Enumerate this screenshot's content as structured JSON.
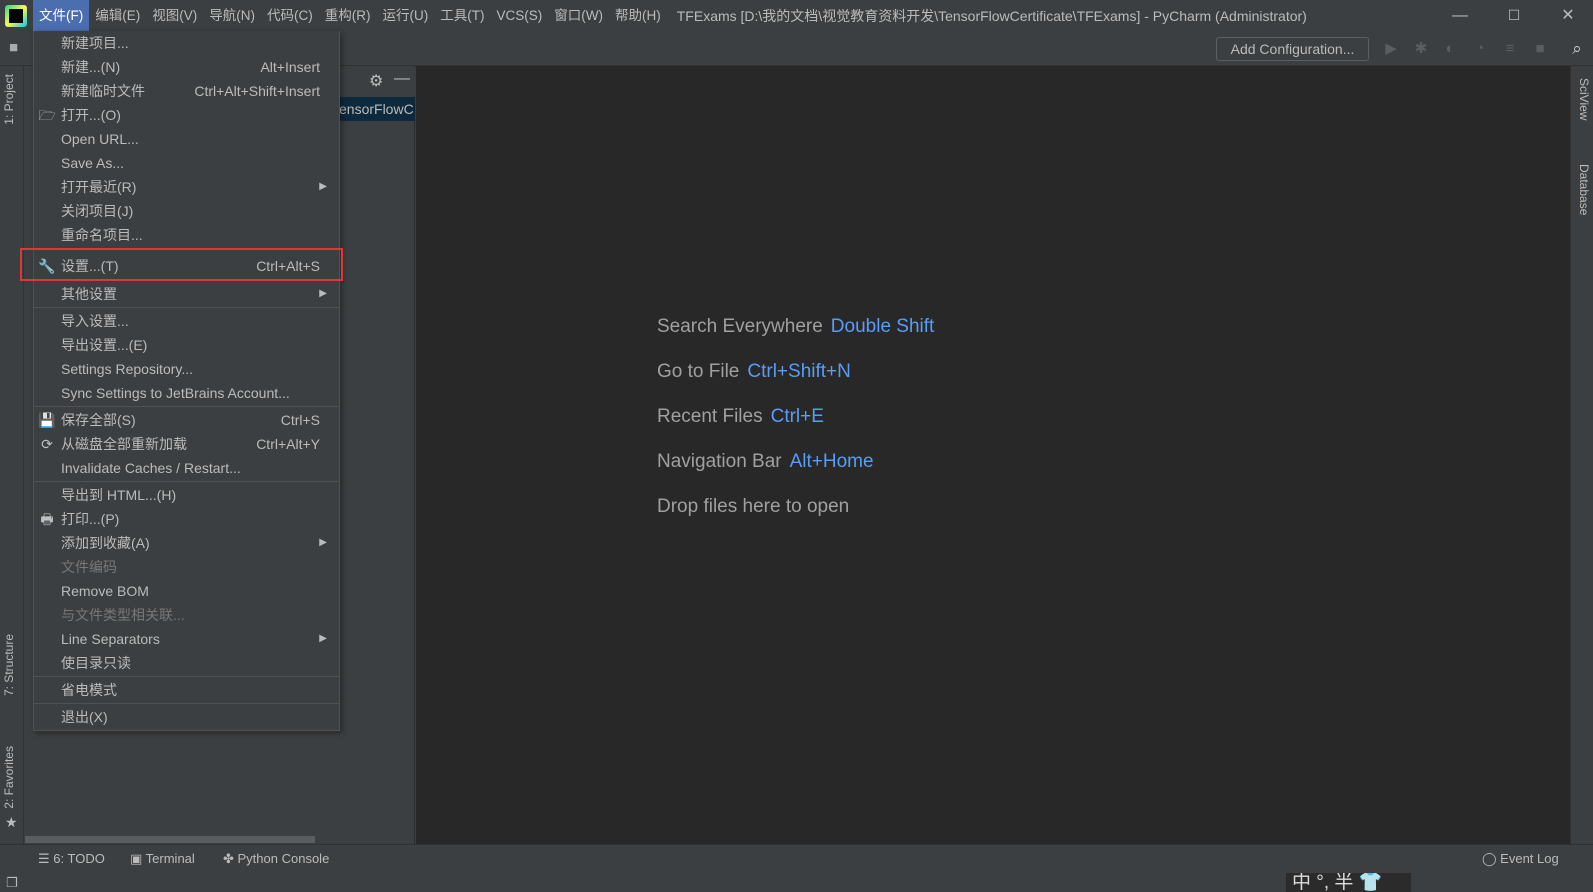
{
  "window": {
    "title": "TFExams [D:\\我的文档\\视觉教育资料开发\\TensorFlowCertificate\\TFExams] - PyCharm (Administrator)",
    "minimize": "—",
    "maximize": "☐",
    "close": "✕"
  },
  "menubar": [
    "文件(F)",
    "编辑(E)",
    "视图(V)",
    "导航(N)",
    "代码(C)",
    "重构(R)",
    "运行(U)",
    "工具(T)",
    "VCS(S)",
    "窗口(W)",
    "帮助(H)"
  ],
  "toolbar": {
    "add_configuration": "Add Configuration..."
  },
  "project_panel": {
    "selected_fragment": "ensorFlowC"
  },
  "left_tabs": {
    "project": "1: Project",
    "structure": "7: Structure",
    "favorites": "2: Favorites"
  },
  "right_tabs": {
    "sciview": "SciView",
    "database": "Database"
  },
  "editor_hints": [
    {
      "label": "Search Everywhere",
      "key": "Double Shift"
    },
    {
      "label": "Go to File",
      "key": "Ctrl+Shift+N"
    },
    {
      "label": "Recent Files",
      "key": "Ctrl+E"
    },
    {
      "label": "Navigation Bar",
      "key": "Alt+Home"
    },
    {
      "label": "Drop files here to open",
      "key": ""
    }
  ],
  "bottom_tabs": {
    "todo": "6: TODO",
    "terminal": "Terminal",
    "python_console": "Python Console",
    "event_log": "Event Log"
  },
  "ime": "中 °, 半 👕",
  "file_menu": [
    {
      "label": "新建项目..."
    },
    {
      "label": "新建...(N)",
      "shortcut": "Alt+Insert"
    },
    {
      "label": "新建临时文件",
      "shortcut": "Ctrl+Alt+Shift+Insert"
    },
    {
      "label": "打开...(O)",
      "icon": "folder-open"
    },
    {
      "label": "Open URL..."
    },
    {
      "label": "Save As..."
    },
    {
      "label": "打开最近(R)",
      "submenu": true
    },
    {
      "label": "关闭项目(J)"
    },
    {
      "label": "重命名项目..."
    },
    {
      "sep": true
    },
    {
      "label": "设置...(T)",
      "shortcut": "Ctrl+Alt+S",
      "icon": "wrench",
      "highlighted": true
    },
    {
      "label": "其他设置",
      "submenu": true
    },
    {
      "sep": true
    },
    {
      "label": "导入设置..."
    },
    {
      "label": "导出设置...(E)"
    },
    {
      "label": "Settings Repository..."
    },
    {
      "label": "Sync Settings to JetBrains Account..."
    },
    {
      "sep": true
    },
    {
      "label": "保存全部(S)",
      "shortcut": "Ctrl+S",
      "icon": "save"
    },
    {
      "label": "从磁盘全部重新加载",
      "shortcut": "Ctrl+Alt+Y",
      "icon": "refresh"
    },
    {
      "label": "Invalidate Caches / Restart..."
    },
    {
      "sep": true
    },
    {
      "label": "导出到 HTML...(H)"
    },
    {
      "label": "打印...(P)",
      "icon": "print"
    },
    {
      "label": "添加到收藏(A)",
      "submenu": true
    },
    {
      "label": "文件编码",
      "disabled": true
    },
    {
      "label": "Remove BOM"
    },
    {
      "label": "与文件类型相关联...",
      "disabled": true
    },
    {
      "label": "Line Separators",
      "submenu": true
    },
    {
      "label": "使目录只读"
    },
    {
      "sep": true
    },
    {
      "label": "省电模式"
    },
    {
      "sep": true
    },
    {
      "label": "退出(X)"
    }
  ],
  "colors": {
    "accent": "#4b6eaf",
    "hint_key": "#589df6",
    "highlight_border": "#e0353a",
    "editor_bg": "#282828",
    "panel_bg": "#3c3f41"
  }
}
